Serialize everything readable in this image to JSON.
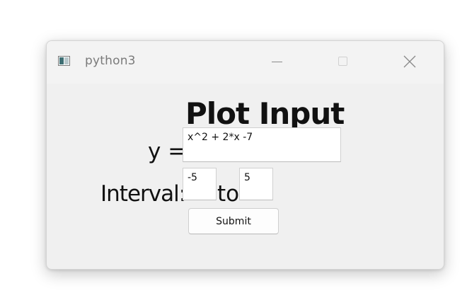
{
  "window": {
    "title": "python3",
    "app_icon": "python-app-icon",
    "controls": {
      "minimize_icon": "minimize-icon",
      "maximize_icon": "maximize-icon",
      "close_icon": "close-icon"
    }
  },
  "form": {
    "heading": "Plot Input",
    "y_label": "y =",
    "function_value": "x^2 + 2*x -7",
    "interval_label": "Interval:",
    "interval_start": "-5",
    "to_label": "to",
    "interval_end": "5",
    "submit_label": "Submit"
  }
}
